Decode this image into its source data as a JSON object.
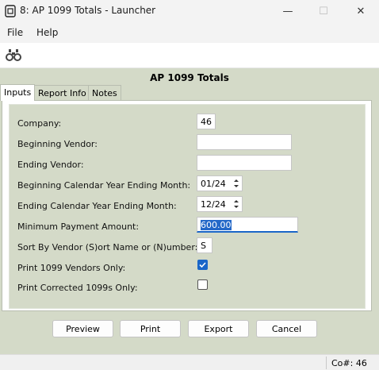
{
  "window": {
    "title": "8: AP 1099 Totals - Launcher",
    "min_glyph": "—",
    "max_glyph": "☐",
    "close_glyph": "✕"
  },
  "menu": {
    "file": "File",
    "help": "Help"
  },
  "form": {
    "title": "AP 1099 Totals"
  },
  "tabs": {
    "inputs": "Inputs",
    "report_info": "Report Info",
    "notes": "Notes"
  },
  "fields": {
    "company_label": "Company:",
    "company_value": "46",
    "beginning_vendor_label": "Beginning Vendor:",
    "beginning_vendor_value": "",
    "ending_vendor_label": "Ending Vendor:",
    "ending_vendor_value": "",
    "beg_month_label": "Beginning Calendar Year Ending Month:",
    "beg_month_value": "01/24",
    "end_month_label": "Ending Calendar Year Ending Month:",
    "end_month_value": "12/24",
    "min_payment_label": "Minimum Payment Amount:",
    "min_payment_value": "600.00",
    "sort_by_label": "Sort By Vendor (S)ort Name or (N)umber:",
    "sort_by_value": "S",
    "print_1099_only_label": "Print 1099 Vendors Only:",
    "print_1099_only_checked": true,
    "print_corrected_label": "Print Corrected 1099s Only:",
    "print_corrected_checked": false
  },
  "buttons": {
    "preview": "Preview",
    "print": "Print",
    "export": "Export",
    "cancel": "Cancel"
  },
  "status": {
    "company": "Co#: 46"
  },
  "colors": {
    "accent": "#1a66c8",
    "form_bg": "#d4dac8"
  }
}
